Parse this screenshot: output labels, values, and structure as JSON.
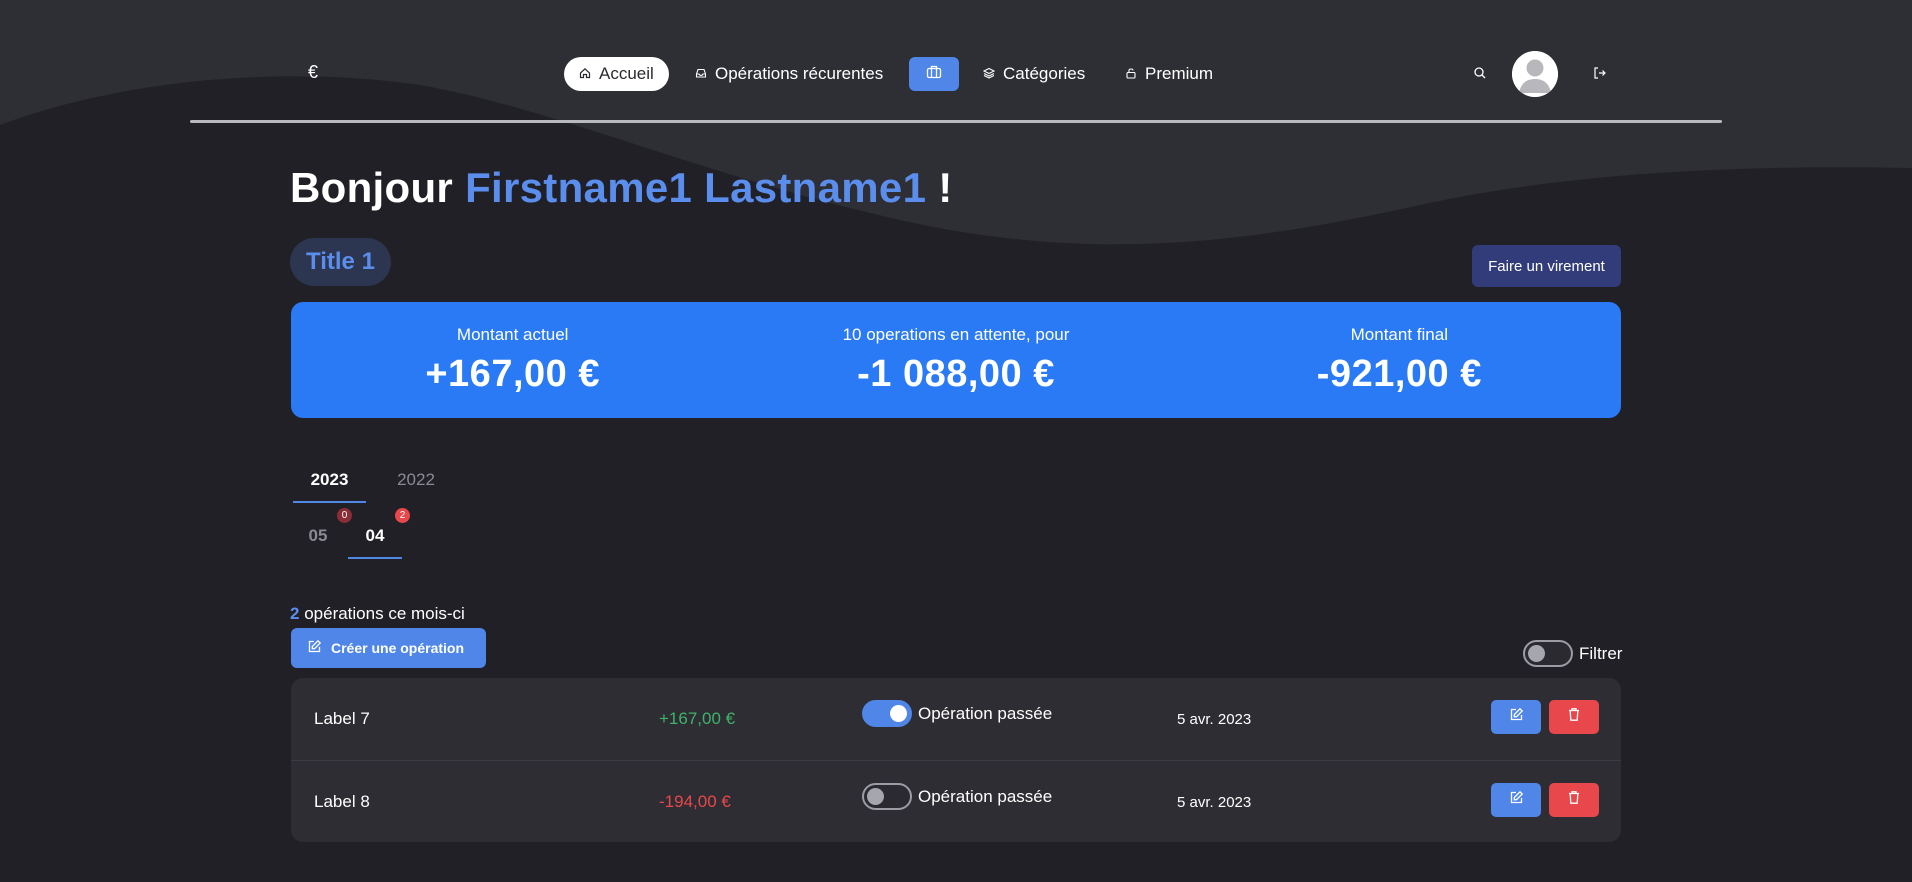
{
  "colors": {
    "background": "#202026",
    "wave": "#2e2e35",
    "accent": "#4f86e8",
    "name_accent": "#5b8eec",
    "summary_bg": "#2a7af6",
    "positive": "#3fb36a",
    "negative": "#e8484c",
    "transfer_btn": "#323c7a"
  },
  "nav": {
    "logo": "€",
    "items": [
      {
        "label": "Accueil",
        "icon": "home-icon",
        "active": true
      },
      {
        "label": "Opérations récurentes",
        "icon": "inbox-icon",
        "active": false
      },
      {
        "label": "Catégories",
        "icon": "layers-icon",
        "active": false
      },
      {
        "label": "Premium",
        "icon": "lock-icon",
        "active": false
      }
    ],
    "center_button_icon": "briefcase-icon",
    "search_icon": "search-icon",
    "logout_icon": "logout-icon"
  },
  "greeting": {
    "prefix": "Bonjour",
    "name": "Firstname1 Lastname1",
    "suffix": "!"
  },
  "account": {
    "title": "Title 1",
    "transfer_label": "Faire un virement"
  },
  "summary": [
    {
      "label": "Montant actuel",
      "value": "+167,00 €"
    },
    {
      "label": "10 operations en attente, pour",
      "value": "-1 088,00 €"
    },
    {
      "label": "Montant final",
      "value": "-921,00 €"
    }
  ],
  "years": {
    "active": "2023",
    "other": "2022"
  },
  "months": [
    {
      "label": "05",
      "badge": "0",
      "active": false
    },
    {
      "label": "04",
      "badge": "2",
      "active": true
    }
  ],
  "operations": {
    "count": "2",
    "count_text": "opérations ce mois-ci",
    "create_label": "Créer une opération",
    "filter_label": "Filtrer",
    "filter_on": false,
    "rows": [
      {
        "label": "Label 7",
        "amount": "+167,00 €",
        "sign": "pos",
        "passed_label": "Opération passée",
        "passed": true,
        "date": "5 avr. 2023"
      },
      {
        "label": "Label 8",
        "amount": "-194,00 €",
        "sign": "neg",
        "passed_label": "Opération passée",
        "passed": false,
        "date": "5 avr. 2023"
      }
    ]
  }
}
